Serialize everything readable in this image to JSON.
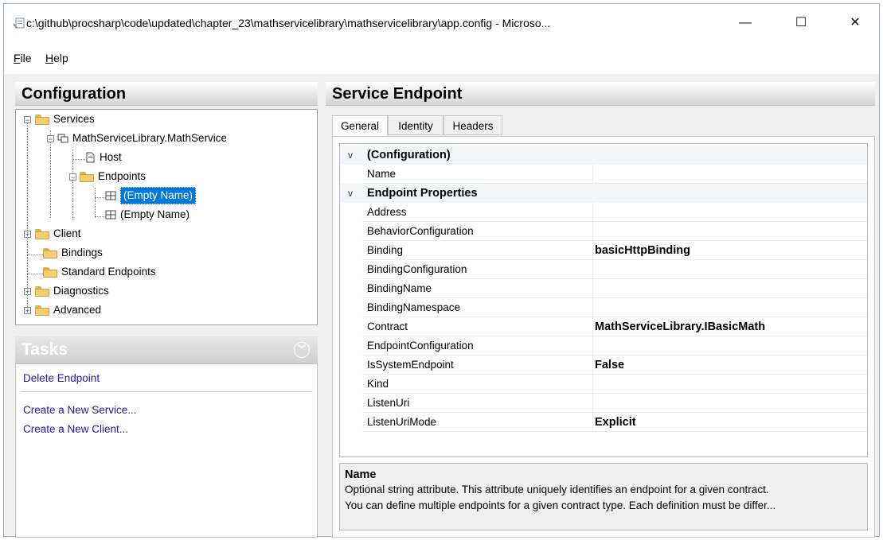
{
  "window": {
    "title": "c:\\github\\procsharp\\code\\updated\\chapter_23\\mathservicelibrary\\mathservicelibrary\\app.config - Microso...",
    "minimize_glyph": "—",
    "maximize_glyph": "☐",
    "close_glyph": "✕"
  },
  "menu": [
    {
      "underline": "F",
      "rest": "ile"
    },
    {
      "underline": "H",
      "rest": "elp"
    }
  ],
  "configuration": {
    "header": "Configuration",
    "tree": [
      {
        "label": "Services"
      },
      {
        "label": "MathServiceLibrary.MathService"
      },
      {
        "label": "Host"
      },
      {
        "label": "Endpoints"
      },
      {
        "label": "(Empty Name)"
      },
      {
        "label": "(Empty Name)"
      },
      {
        "label": "Client"
      },
      {
        "label": "Bindings"
      },
      {
        "label": "Standard Endpoints"
      },
      {
        "label": "Diagnostics"
      },
      {
        "label": "Advanced"
      }
    ]
  },
  "tasks": {
    "header": "Tasks",
    "chevron": "︾",
    "items": [
      "Delete Endpoint",
      "Create a New Service...",
      "Create a New Client..."
    ]
  },
  "endpoint": {
    "header": "Service Endpoint",
    "tabs": [
      "General",
      "Identity",
      "Headers"
    ],
    "active_tab": "General",
    "chevron_glyph": "v",
    "properties": [
      {
        "category": "(Configuration)"
      },
      {
        "name": "Name",
        "value": ""
      },
      {
        "category": "Endpoint Properties"
      },
      {
        "name": "Address",
        "value": ""
      },
      {
        "name": "BehaviorConfiguration",
        "value": ""
      },
      {
        "name": "Binding",
        "value": "basicHttpBinding"
      },
      {
        "name": "BindingConfiguration",
        "value": ""
      },
      {
        "name": "BindingName",
        "value": ""
      },
      {
        "name": "BindingNamespace",
        "value": ""
      },
      {
        "name": "Contract",
        "value": "MathServiceLibrary.IBasicMath"
      },
      {
        "name": "EndpointConfiguration",
        "value": ""
      },
      {
        "name": "IsSystemEndpoint",
        "value": "False"
      },
      {
        "name": "Kind",
        "value": ""
      },
      {
        "name": "ListenUri",
        "value": ""
      },
      {
        "name": "ListenUriMode",
        "value": "Explicit"
      }
    ],
    "description": {
      "title": "Name",
      "line1": "Optional string attribute. This attribute uniquely identifies an endpoint for a given contract.",
      "line2": "You can define multiple endpoints for a given contract type. Each definition must be differ..."
    }
  }
}
